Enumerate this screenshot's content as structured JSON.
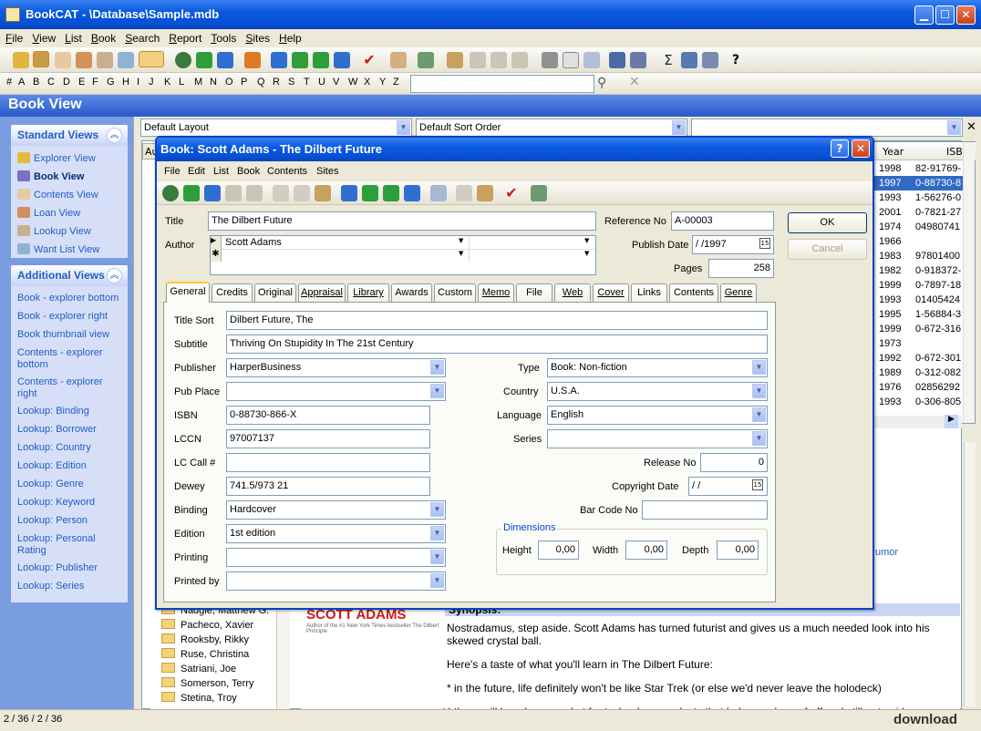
{
  "window": {
    "title": "BookCAT - \\Database\\Sample.mdb",
    "min": "▁",
    "max": "☐",
    "close": "✕"
  },
  "menu": [
    "File",
    "View",
    "List",
    "Book",
    "Search",
    "Report",
    "Tools",
    "Sites",
    "Help"
  ],
  "alphabet": [
    "#",
    "A",
    "B",
    "C",
    "D",
    "E",
    "F",
    "G",
    "H",
    "I",
    "J",
    "K",
    "L",
    "M",
    "N",
    "O",
    "P",
    "Q",
    "R",
    "S",
    "T",
    "U",
    "V",
    "W",
    "X",
    "Y",
    "Z"
  ],
  "header": {
    "title": "Book View"
  },
  "layout": {
    "layout": "Default Layout",
    "sort": "Default Sort Order"
  },
  "standard_views": {
    "title": "Standard Views",
    "items": [
      "Explorer View",
      "Book View",
      "Contents View",
      "Loan View",
      "Lookup View",
      "Want List View"
    ]
  },
  "additional_views": {
    "title": "Additional Views",
    "items": [
      "Book - explorer bottom",
      "Book - explorer right",
      "Book thumbnail view",
      "Contents - explorer bottom",
      "Contents - explorer right",
      "Lookup: Binding",
      "Lookup: Borrower",
      "Lookup: Country",
      "Lookup: Edition",
      "Lookup: Genre",
      "Lookup: Keyword",
      "Lookup: Person",
      "Lookup: Personal Rating",
      "Lookup: Publisher",
      "Lookup: Series"
    ]
  },
  "grid": {
    "headers": [
      "Year",
      "ISB"
    ],
    "col_partial": "Au",
    "rows": [
      [
        "1998",
        "82-91769-"
      ],
      [
        "1997",
        "0-88730-8"
      ],
      [
        "1993",
        "1-56276-0"
      ],
      [
        "2001",
        "0-7821-27"
      ],
      [
        "1974",
        "04980741"
      ],
      [
        "1966",
        ""
      ],
      [
        "1983",
        "97801400"
      ],
      [
        "1982",
        "0-918372-"
      ],
      [
        "1999",
        "0-7897-18"
      ],
      [
        "1993",
        "01405424"
      ],
      [
        "1995",
        "1-56884-3"
      ],
      [
        "1999",
        "0-672-316"
      ],
      [
        "1973",
        ""
      ],
      [
        "1992",
        "0-672-301"
      ],
      [
        "1989",
        "0-312-082"
      ],
      [
        "1976",
        "02856292"
      ],
      [
        "1993",
        "0-306-805"
      ]
    ],
    "selected": 1
  },
  "tree": [
    "Nadgie, Matthew G.",
    "Pacheco, Xavier",
    "Rooksby, Rikky",
    "Ruse, Christina",
    "Satriani, Joe",
    "Somerson, Terry",
    "Stetina, Troy"
  ],
  "cover": {
    "brand": "SCOTT ADAMS",
    "tagline": "Author of the #1 New York Times bestseller The Dilbert Principle"
  },
  "synopsis": {
    "heading": "Synopsis:",
    "p1": "Nostradamus, step aside. Scott Adams has turned futurist and gives us a much needed look into his skewed crystal ball.",
    "p2": "Here's a taste of what you'll learn in The Dilbert Future:",
    "p3": "* in the future, life definitely won't be like Star Trek (or else we'd never leave the holodeck)",
    "p4": "* there will be a huge market for technology products that help people goof off and still get paid",
    "behind_text": "umor"
  },
  "dialog": {
    "title": "Book: Scott Adams - The Dilbert Future",
    "help": "?",
    "close": "✕",
    "menu": [
      "File",
      "Edit",
      "List",
      "Book",
      "Contents",
      "Sites"
    ],
    "title_label": "Title",
    "title_value": "The Dilbert Future",
    "author_label": "Author",
    "author_value": "Scott Adams",
    "refno_label": "Reference No",
    "refno_value": "A-00003",
    "pubdate_label": "Publish Date",
    "pubdate_value": " /  /1997",
    "pages_label": "Pages",
    "pages_value": "258",
    "ok": "OK",
    "cancel": "Cancel",
    "tabs": [
      "General",
      "Credits",
      "Original",
      "Appraisal",
      "Library",
      "Awards",
      "Custom",
      "Memo",
      "File",
      "Web",
      "Cover",
      "Links",
      "Contents",
      "Genre"
    ],
    "general": {
      "title_sort_label": "Title Sort",
      "title_sort": "Dilbert Future, The",
      "subtitle_label": "Subtitle",
      "subtitle": "Thriving On Stupidity In The 21st Century",
      "publisher_label": "Publisher",
      "publisher": "HarperBusiness",
      "pubplace_label": "Pub Place",
      "pubplace": "",
      "isbn_label": "ISBN",
      "isbn": "0-88730-866-X",
      "lccn_label": "LCCN",
      "lccn": "97007137",
      "lccall_label": "LC Call #",
      "lccall": "",
      "dewey_label": "Dewey",
      "dewey": "741.5/973 21",
      "binding_label": "Binding",
      "binding": "Hardcover",
      "edition_label": "Edition",
      "edition": "1st edition",
      "printing_label": "Printing",
      "printing": "",
      "printedby_label": "Printed by",
      "printedby": "",
      "type_label": "Type",
      "type": "Book: Non-fiction",
      "country_label": "Country",
      "country": "U.S.A.",
      "language_label": "Language",
      "language": "English",
      "series_label": "Series",
      "series": "",
      "release_label": "Release No",
      "release": "0",
      "copyright_label": "Copyright Date",
      "copyright": " /  /",
      "barcode_label": "Bar Code No",
      "barcode": "",
      "dimensions_label": "Dimensions",
      "height_label": "Height",
      "height": "0,00",
      "width_label": "Width",
      "width": "0,00",
      "depth_label": "Depth",
      "depth": "0,00"
    }
  },
  "status": {
    "text": "2 / 36 / 2 / 36"
  },
  "watermark": "download"
}
